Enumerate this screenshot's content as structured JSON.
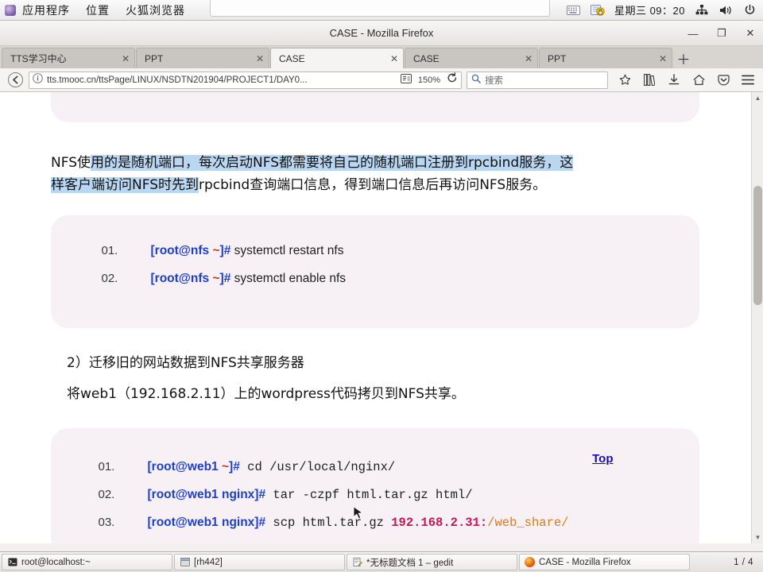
{
  "gnome_panel": {
    "menus": [
      "应用程序",
      "位置",
      "火狐浏览器"
    ],
    "clock": "星期三  09：20",
    "icons": [
      "keyboard-icon",
      "lock-screen-icon",
      "network-icon",
      "volume-icon",
      "power-icon"
    ]
  },
  "window": {
    "title": "CASE - Mozilla Firefox",
    "buttons": {
      "minimize": "—",
      "maximize": "❐",
      "close": "✕"
    }
  },
  "tabs": [
    {
      "label": "TTS学习中心",
      "close": "✕",
      "active": false
    },
    {
      "label": "PPT",
      "close": "✕",
      "active": false
    },
    {
      "label": "CASE",
      "close": "✕",
      "active": true
    },
    {
      "label": "CASE",
      "close": "✕",
      "active": false
    },
    {
      "label": "PPT",
      "close": "✕",
      "active": false
    }
  ],
  "newtab_label": "＋",
  "navbar": {
    "back": "back-icon",
    "info": "site-info-icon",
    "url": "tts.tmooc.cn/ttsPage/LINUX/NSDTN201904/PROJECT1/DAY0...",
    "reader_icon": "reader-view-icon",
    "zoom": "150%",
    "reload": "reload-icon",
    "search_placeholder": "搜索",
    "search_icon": "search-icon",
    "icons": [
      "bookmark-star-icon",
      "library-icon",
      "downloads-icon",
      "home-icon",
      "pocket-icon",
      "menu-icon"
    ]
  },
  "content": {
    "code_block_top": {
      "lines": [
        {
          "no": "",
          "text": ""
        }
      ]
    },
    "paragraph1": {
      "part_plain_1": "NFS使",
      "part_selected_1": "用的是随机端口，每次启动NFS都需要将自己的随机端口注册到rpcbind服务，这",
      "part_selected_2": "样客户端访问NFS时先到",
      "part_plain_2": "rpcbind查询端口信息，得到端口信息后再访问NFS服务。"
    },
    "code_block_1": {
      "lines": [
        {
          "no": "01.",
          "prompt": "[root@nfs ~]#",
          "cmd": " systemctl restart nfs"
        },
        {
          "no": "02.",
          "prompt": "[root@nfs ~]#",
          "cmd": " systemctl enable nfs"
        }
      ]
    },
    "heading1": "2）迁移旧的网站数据到NFS共享服务器",
    "paragraph2": "将web1（192.168.2.11）上的wordpress代码拷贝到NFS共享。",
    "top_link": "Top",
    "code_block_2": {
      "lines": [
        {
          "no": "01.",
          "prompt": "[root@web1 ~]#",
          "cmd": " cd ",
          "path": "/usr/local/nginx/",
          "ip": "",
          "ippath": ""
        },
        {
          "no": "02.",
          "prompt": "[root@web1 nginx]#",
          "cmd": " tar -czpf html.tar.gz html/",
          "path": "",
          "ip": "",
          "ippath": ""
        },
        {
          "no": "03.",
          "prompt": "[root@web1 nginx]#",
          "cmd": " scp html.tar.gz ",
          "path": "",
          "ip": "192.168.2.31:",
          "ippath": "/web_share/"
        }
      ]
    }
  },
  "scrollbar": {
    "up": "▲",
    "down": "▼"
  },
  "taskbar": {
    "items": [
      {
        "label": "root@localhost:~",
        "icon": "terminal-icon",
        "active": false
      },
      {
        "label": "[rh442]",
        "icon": "window-icon",
        "active": false
      },
      {
        "label": "*无标题文档 1 – gedit",
        "icon": "gedit-icon",
        "active": false
      },
      {
        "label": "CASE - Mozilla Firefox",
        "icon": "firefox-icon",
        "active": true
      }
    ],
    "pager": "1 / 4"
  }
}
